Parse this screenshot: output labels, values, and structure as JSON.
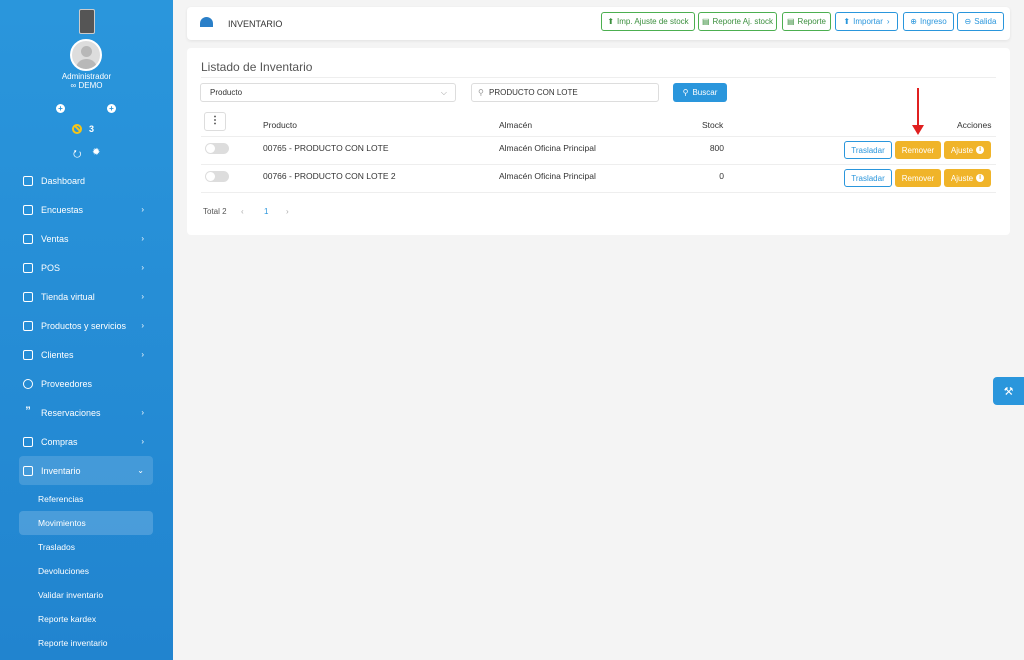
{
  "sidebar": {
    "user_name": "Administrador",
    "company": "∞ DEMO",
    "notification_count": "3",
    "plus_left": "+",
    "plus_right": "+",
    "items": [
      {
        "label": "Dashboard",
        "icon": "dashboard-icon",
        "chevron": ""
      },
      {
        "label": "Encuestas",
        "icon": "document-icon",
        "chevron": "›"
      },
      {
        "label": "Ventas",
        "icon": "document-icon",
        "chevron": "›"
      },
      {
        "label": "POS",
        "icon": "cart-icon",
        "chevron": "›"
      },
      {
        "label": "Tienda virtual",
        "icon": "store-icon",
        "chevron": "›"
      },
      {
        "label": "Productos y servicios",
        "icon": "boxes-icon",
        "chevron": "›"
      },
      {
        "label": "Clientes",
        "icon": "boxes-icon",
        "chevron": "›"
      },
      {
        "label": "Proveedores",
        "icon": "user-icon",
        "chevron": ""
      },
      {
        "label": "Reservaciones",
        "icon": "quote-icon",
        "chevron": "›"
      },
      {
        "label": "Compras",
        "icon": "bag-icon",
        "chevron": "›"
      },
      {
        "label": "Inventario",
        "icon": "book-icon",
        "chevron": "⌄"
      }
    ],
    "subitems": [
      "Referencias",
      "Movimientos",
      "Traslados",
      "Devoluciones",
      "Validar inventario",
      "Reporte kardex",
      "Reporte inventario"
    ]
  },
  "header": {
    "title": "INVENTARIO",
    "buttons": {
      "imp_ajuste": "Imp. Ajuste de stock",
      "reporte_aj": "Reporte Aj. stock",
      "reporte": "Reporte",
      "importar": "Importar",
      "importar_chevron": "›",
      "ingreso": "Ingreso",
      "salida": "Salida"
    }
  },
  "main": {
    "card_title": "Listado de Inventario",
    "filter_select": "Producto",
    "search_value": "PRODUCTO CON LOTE",
    "search_button": "Buscar",
    "columns": {
      "producto": "Producto",
      "almacen": "Almacén",
      "stock": "Stock",
      "acciones": "Acciones"
    },
    "rows": [
      {
        "producto": "00765 - PRODUCTO CON LOTE",
        "almacen": "Almacén Oficina Principal",
        "stock": "800"
      },
      {
        "producto": "00766 - PRODUCTO CON LOTE 2",
        "almacen": "Almacén Oficina Principal",
        "stock": "0"
      }
    ],
    "actions": {
      "trasladar": "Trasladar",
      "remover": "Remover",
      "ajuste": "Ajuste"
    },
    "pagination": {
      "total": "Total 2",
      "prev": "‹",
      "page": "1",
      "next": "›"
    }
  },
  "colors": {
    "primary": "#2a96dc",
    "warning": "#f0b429",
    "success": "#4caf50",
    "annotation": "#e02020"
  }
}
